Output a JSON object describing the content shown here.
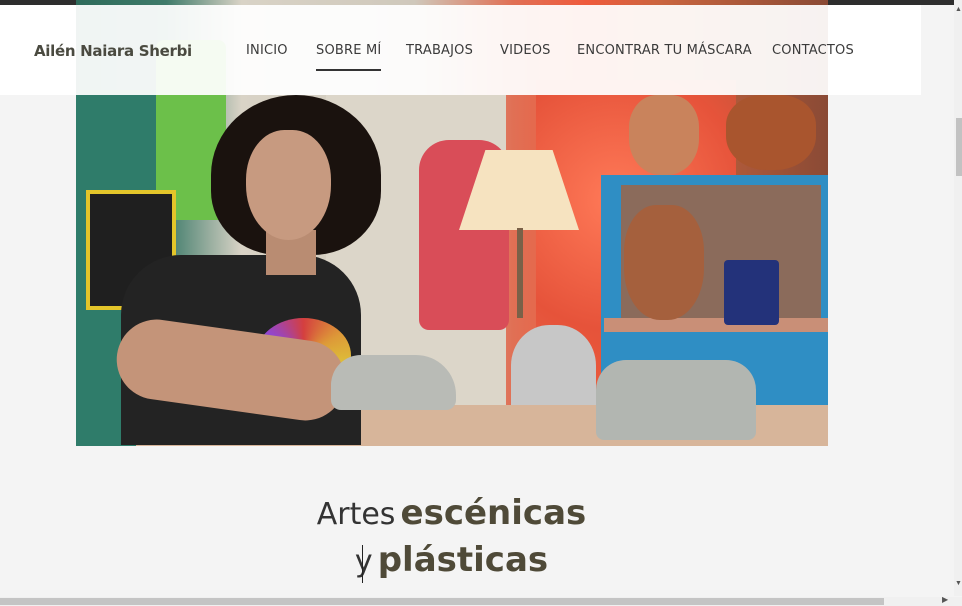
{
  "brand": {
    "name": "Ailén Naiara Sherbi"
  },
  "nav": {
    "items": [
      {
        "label": "INICIO",
        "active": false
      },
      {
        "label": "SOBRE MÍ",
        "active": true
      },
      {
        "label": "TRABAJOS",
        "active": false
      },
      {
        "label": "VIDEOS",
        "active": false
      },
      {
        "label": "ENCONTRAR TU MÁSCARA",
        "active": false
      },
      {
        "label": "CONTACTOS",
        "active": false
      }
    ]
  },
  "hero": {
    "image_description": "photo-artist-in-mask-workshop",
    "colors": {
      "warm_light": "#ef5a3c",
      "teal_wall": "#2f7c6a",
      "shelf_blue": "#2f8ec4"
    }
  },
  "heading": {
    "line1_light": "Artes",
    "line1_bold": "escénicas",
    "line2_light": "y",
    "line2_bold": "plásticas"
  },
  "theme": {
    "background": "#f4f4f4",
    "accent_text": "#4f4a38",
    "header_bg": "#ffffff"
  },
  "scroll": {
    "up_icon": "chevron-up-icon",
    "down_icon": "chevron-down-icon",
    "right_icon": "chevron-right-icon"
  }
}
